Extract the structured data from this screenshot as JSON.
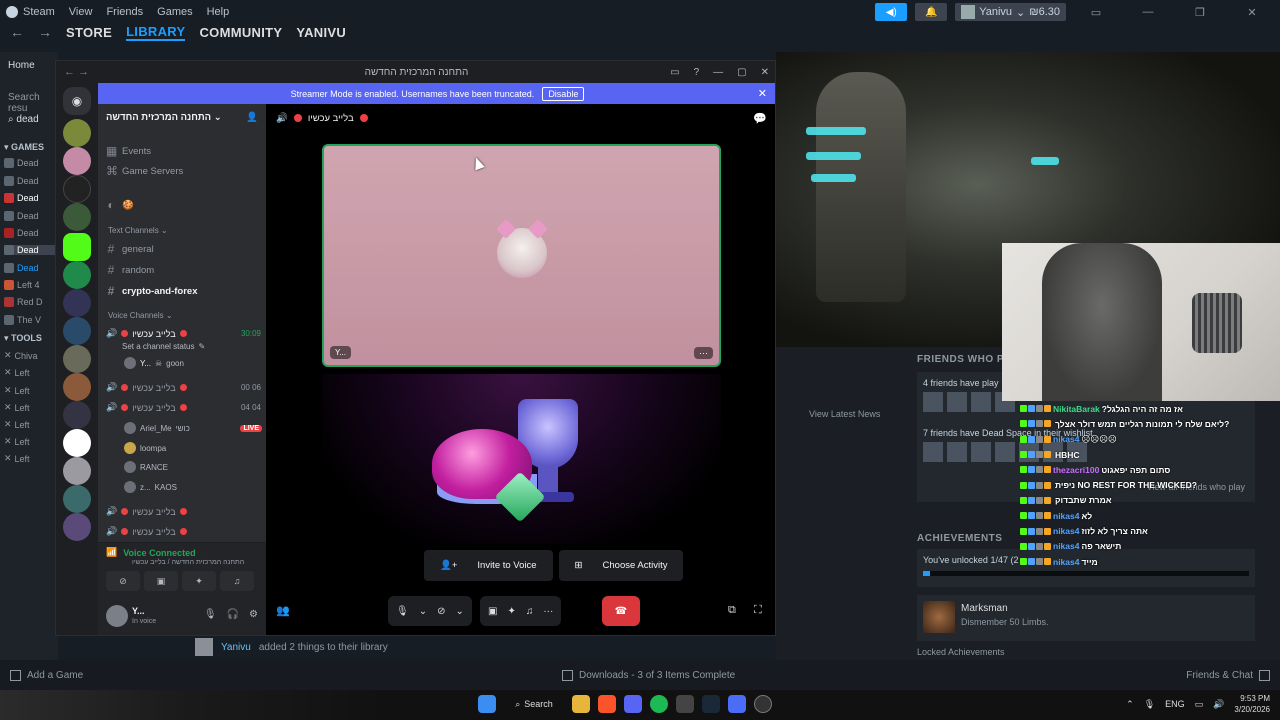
{
  "steam": {
    "menu": [
      "Steam",
      "View",
      "Friends",
      "Games",
      "Help"
    ],
    "account": {
      "name": "Yanivu",
      "balance": "₪6.30"
    },
    "nav_tabs": [
      "STORE",
      "LIBRARY",
      "COMMUNITY",
      "YANIVU"
    ],
    "sidebar": {
      "home": "Home",
      "search_results": "Search resu",
      "search_value": "dead",
      "games_header": "GAMES",
      "tools_header": "TOOLS",
      "games": [
        "Dead",
        "Dead",
        "Dead",
        "Dead",
        "Dead",
        "Dead",
        "Dead",
        "Left 4",
        "Red D",
        "The V"
      ],
      "tools": [
        "Chiva",
        "Left",
        "Left",
        "Left",
        "Left",
        "Left",
        "Left"
      ]
    },
    "friends_who_play_title": "FRIENDS WHO PI",
    "friends_play_count": "4 friends have play",
    "friends_wishlist": "7 friends have Dead Space in their wishlist",
    "view_all_friends": "View all friends who play",
    "view_latest_news": "View Latest News",
    "achievements_title": "ACHIEVEMENTS",
    "achievements_progress": "You've unlocked 1/47 (2",
    "achievements_fraction": 0.02,
    "achievement": {
      "name": "Marksman",
      "desc": "Dismember 50 Limbs."
    },
    "locked_achievements": "Locked Achievements",
    "activity": {
      "user": "Yanivu",
      "text": "added 2 things to their library"
    },
    "bottom": {
      "add_game": "Add a Game",
      "downloads": "Downloads - 3 of 3 Items Complete",
      "friends_chat": "Friends & Chat"
    }
  },
  "discord": {
    "window_title": "התחנה המרכזית החדשה",
    "streamer_banner": "Streamer Mode is enabled. Usernames have been truncated.",
    "disable_label": "Disable",
    "server_name": "התחנה המרכזית החדשה",
    "channels_top": [
      "Events",
      "Game Servers"
    ],
    "text_channels_label": "Text Channels",
    "text_channels": [
      "general",
      "random",
      "crypto-and-forex"
    ],
    "voice_channels_label": "Voice Channels",
    "voice_channel_name": "בלייב עכשיו",
    "voice_timer": "30:09",
    "channel_status": "Set a channel status",
    "vc_user_1": "Y...",
    "vc_user_1_tag": "goon",
    "vc2_counts": [
      "00",
      "06"
    ],
    "vc3_counts": [
      "04",
      "04"
    ],
    "vc3_users": [
      {
        "name": "Ariel_Me",
        "tag": "כושי",
        "live": "LIVE"
      },
      {
        "name": "loompa",
        "tag": "",
        "live": ""
      },
      {
        "name": "RANCE",
        "tag": "",
        "live": ""
      },
      {
        "name": "z...",
        "tag": "KAOS",
        "live": ""
      }
    ],
    "voice_connected": "Voice Connected",
    "voice_connected_sub": "התחנה המרכזית החדשה / בלייב עכשיו",
    "user": {
      "name": "Y...",
      "status": "In voice"
    },
    "stage_channel": "בלייב עכשיו",
    "tile_user": "Y...",
    "invite_label": "Invite to Voice",
    "choose_activity_label": "Choose Activity"
  },
  "chat_overlay": [
    {
      "user": "NikitaBarak",
      "msg": "?אז מה זה היה הגלגל",
      "color": "#3ddc84"
    },
    {
      "user": "",
      "msg": "ליאם שלח לי תמונות רגליים תמש דולר אצלך?",
      "color": "#ffffff"
    },
    {
      "user": "nikas4",
      "msg": "☹☹☹☹",
      "color": "#4fa3ff"
    },
    {
      "user": "",
      "msg": "HBHC",
      "color": "#ffffff"
    },
    {
      "user": "thezacri100",
      "msg": "סתום תפה יפאגוט",
      "color": "#c86bff"
    },
    {
      "user": "",
      "msg": "ניפית NO REST FOR THE WICKED?",
      "color": "#ffffff"
    },
    {
      "user": "",
      "msg": "אמרת שתבדוק",
      "color": "#ffffff"
    },
    {
      "user": "nikas4",
      "msg": "לא",
      "color": "#4fa3ff"
    },
    {
      "user": "nikas4",
      "msg": "אתה צריך לא לזוז",
      "color": "#4fa3ff"
    },
    {
      "user": "nikas4",
      "msg": "תישאר פה",
      "color": "#4fa3ff"
    },
    {
      "user": "nikas4",
      "msg": "מייד",
      "color": "#4fa3ff"
    }
  ],
  "taskbar": {
    "search": "Search",
    "language": "ENG",
    "time": "9:53 PM",
    "date": "3/20/2026"
  },
  "colors": {
    "steam_blue": "#1a9fff",
    "discord_blurple": "#5865f2",
    "discord_green": "#23a559",
    "discord_red": "#da373c"
  }
}
